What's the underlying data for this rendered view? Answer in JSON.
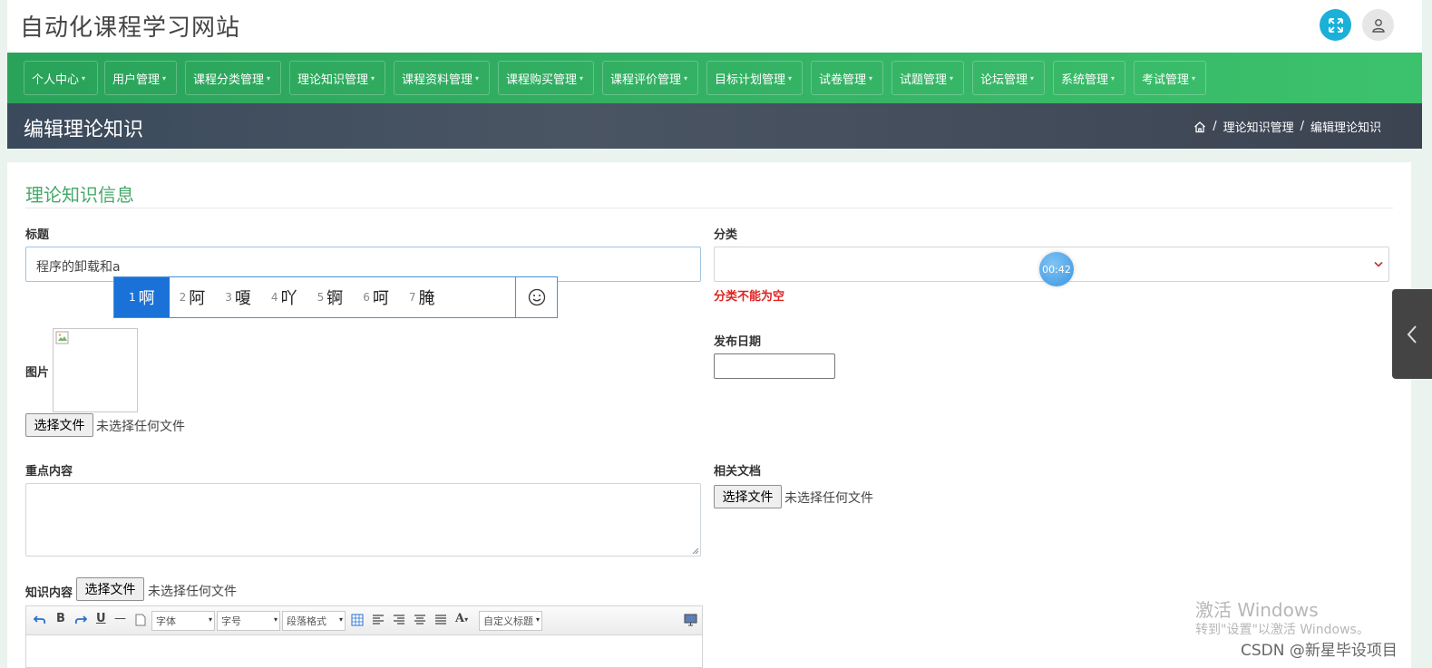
{
  "site": {
    "title": "自动化课程学习网站"
  },
  "colors": {
    "nav_green": "#2aa35a",
    "accent_blue": "#1bb0d8",
    "error_red": "#e02222",
    "section_green": "#46a86a",
    "ime_selected": "#1a72d8"
  },
  "nav": {
    "items": [
      "个人中心",
      "用户管理",
      "课程分类管理",
      "理论知识管理",
      "课程资料管理",
      "课程购买管理",
      "课程评价管理",
      "目标计划管理",
      "试卷管理",
      "试题管理",
      "论坛管理",
      "系统管理",
      "考试管理"
    ]
  },
  "page": {
    "title": "编辑理论知识",
    "breadcrumb": [
      "理论知识管理",
      "编辑理论知识"
    ]
  },
  "form": {
    "section_title": "理论知识信息",
    "title_label": "标题",
    "title_value": "程序的卸载和a",
    "category_label": "分类",
    "category_error": "分类不能为空",
    "image_label": "图片",
    "publish_date_label": "发布日期",
    "file_button": "选择文件",
    "no_file": "未选择任何文件",
    "key_content_label": "重点内容",
    "related_doc_label": "相关文档",
    "knowledge_content_label": "知识内容"
  },
  "ime": {
    "candidates": [
      {
        "num": "1",
        "char": "啊"
      },
      {
        "num": "2",
        "char": "阿"
      },
      {
        "num": "3",
        "char": "嗄"
      },
      {
        "num": "4",
        "char": "吖"
      },
      {
        "num": "5",
        "char": "锕"
      },
      {
        "num": "6",
        "char": "呵"
      },
      {
        "num": "7",
        "char": "腌"
      }
    ]
  },
  "timer": {
    "text": "00:42"
  },
  "editor": {
    "font_select": "字体",
    "size_select": "字号",
    "para_select": "段落格式",
    "custom_title": "自定义标题"
  },
  "watermark": {
    "line1": "激活 Windows",
    "line2": "转到\"设置\"以激活 Windows。",
    "csdn": "CSDN @新星毕设项目"
  }
}
